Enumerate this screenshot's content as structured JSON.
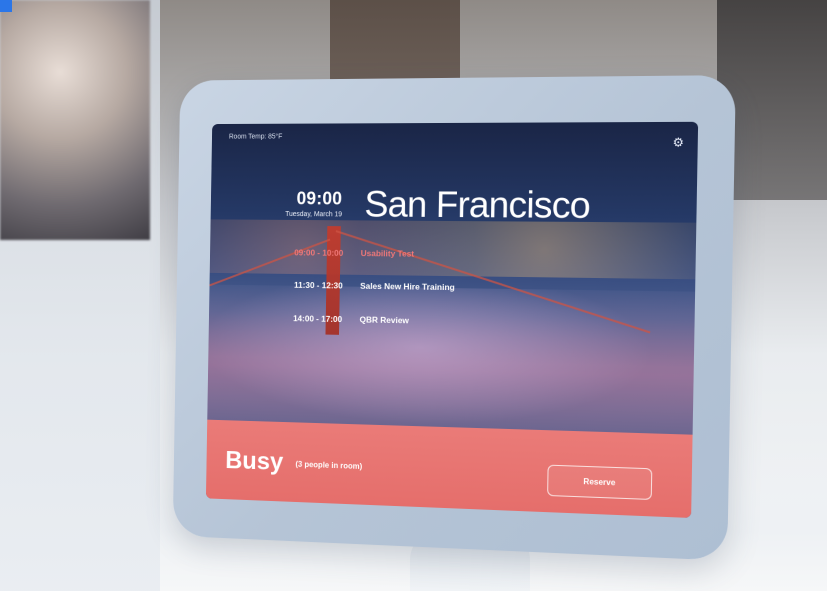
{
  "device": {
    "room_temp": "Room Temp: 85°F",
    "settings_icon": "gear-icon",
    "clock": {
      "time": "09:00",
      "date": "Tuesday, March 19"
    },
    "room_name": "San Francisco",
    "schedule": [
      {
        "time": "09:00 - 10:00",
        "title": "Usability Test",
        "active": true
      },
      {
        "time": "11:30 - 12:30",
        "title": "Sales New Hire Training",
        "active": false
      },
      {
        "time": "14:00 - 17:00",
        "title": "QBR Review",
        "active": false
      }
    ],
    "status": {
      "label": "Busy",
      "detail": "(3 people in room)"
    },
    "reserve_button_label": "Reserve"
  },
  "colors": {
    "accent_blue": "#2b76e8",
    "busy_red": "#e56e6b",
    "active_event_red": "#f07878"
  }
}
